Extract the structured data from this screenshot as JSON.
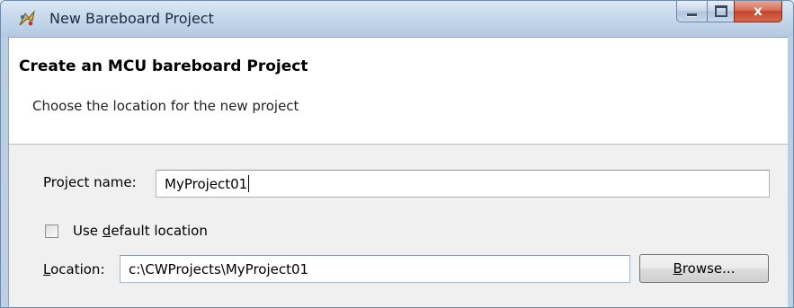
{
  "window": {
    "title": "New Bareboard Project",
    "icon": "wizard-app-icon",
    "controls": {
      "minimize_icon": "minimize-icon",
      "maximize_icon": "maximize-icon",
      "close_icon": "close-icon",
      "close_glyph": "x"
    }
  },
  "banner": {
    "title": "Create an MCU bareboard Project",
    "description": "Choose the location for the new project"
  },
  "form": {
    "project_name_label": "Project name:",
    "project_name_value": "MyProject01",
    "default_location": {
      "checked": false,
      "label_pre": "Use ",
      "label_mnemonic": "d",
      "label_post": "efault location"
    },
    "location_label_mnemonic": "L",
    "location_label_rest": "ocation:",
    "location_value": "c:\\CWProjects\\MyProject01",
    "browse": {
      "label_mnemonic": "B",
      "label_rest": "rowse..."
    }
  },
  "colors": {
    "close_button": "#c4452b",
    "title_bar": "#c3d6ea",
    "banner_bg": "#ffffff",
    "client_bg": "#f0f0f0"
  }
}
